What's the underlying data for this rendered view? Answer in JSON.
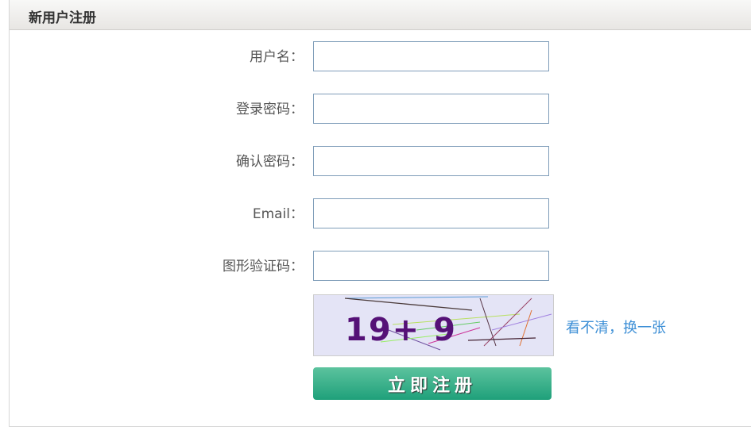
{
  "header": {
    "title": "新用户注册"
  },
  "form": {
    "fields": [
      {
        "label": "用户名：",
        "value": ""
      },
      {
        "label": "登录密码：",
        "value": ""
      },
      {
        "label": "确认密码：",
        "value": ""
      },
      {
        "label": "Email：",
        "value": ""
      },
      {
        "label": "图形验证码：",
        "value": ""
      }
    ],
    "captcha": {
      "text": "19+ 9",
      "refresh_label": "看不清，换一张"
    },
    "submit_label": "立即注册"
  }
}
